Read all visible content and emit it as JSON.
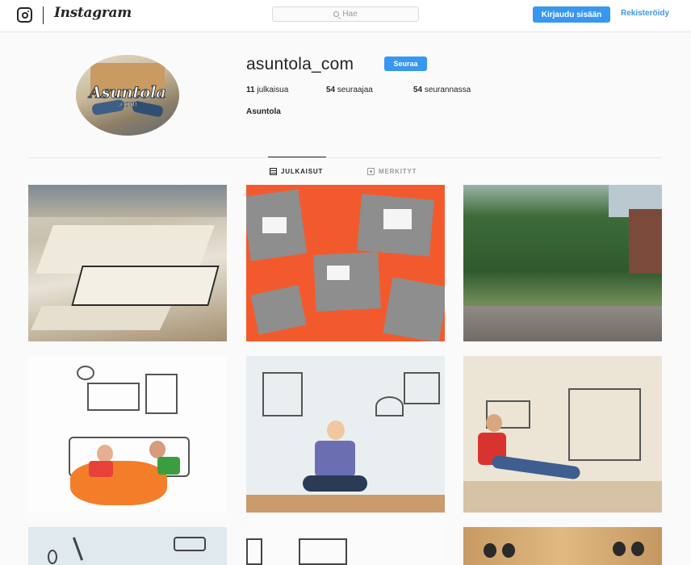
{
  "nav": {
    "brand": "Instagram",
    "search_placeholder": "Hae",
    "login_label": "Kirjaudu sisään",
    "register_label": "Rekisteröidy",
    "accent": "#3897f0"
  },
  "profile": {
    "username": "asuntola_com",
    "follow_label": "Seuraa",
    "avatar_text": "Asuntola",
    "avatar_sub": ".com",
    "stats": [
      {
        "count": "11",
        "label": "julkaisua"
      },
      {
        "count": "54",
        "label": "seuraajaa"
      },
      {
        "count": "54",
        "label": "seurannassa"
      }
    ],
    "full_name": "Asuntola"
  },
  "tabs": [
    {
      "label": "JULKAISUT",
      "icon": "grid-icon",
      "active": true
    },
    {
      "label": "MERKITYT",
      "icon": "tag-icon",
      "active": false
    }
  ],
  "posts": [
    {
      "subject": "architecture-model-city"
    },
    {
      "subject": "building-models-on-orange"
    },
    {
      "subject": "green-wall-street"
    },
    {
      "subject": "family-on-beanbag-sketch-room"
    },
    {
      "subject": "woman-sitting-sketch-living-room"
    },
    {
      "subject": "girl-sitting-sketch-room"
    },
    {
      "subject": "tools-sketch"
    },
    {
      "subject": "home-sweet-home-sketch"
    },
    {
      "subject": "cardboard-box-faces"
    }
  ]
}
